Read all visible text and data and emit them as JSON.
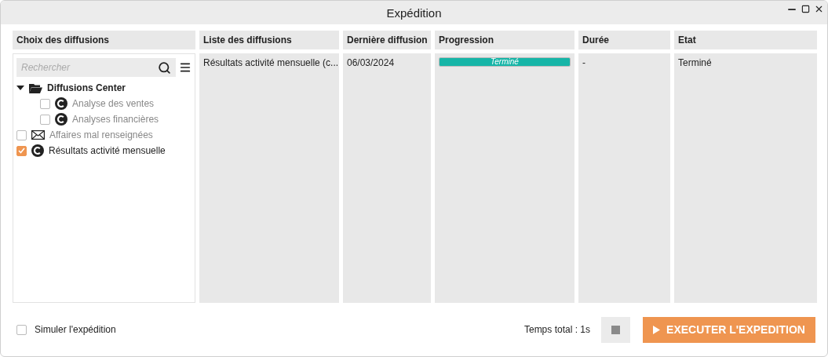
{
  "window": {
    "title": "Expédition"
  },
  "sidebar": {
    "header": "Choix des diffusions",
    "search": {
      "placeholder": "Rechercher"
    },
    "tree": [
      {
        "label": "Diffusions Center",
        "kind": "folder",
        "expanded": true,
        "children": [
          {
            "label": "Analyse des ventes",
            "kind": "report",
            "checked": false
          },
          {
            "label": "Analyses financières",
            "kind": "report",
            "checked": false
          }
        ]
      },
      {
        "label": "Affaires mal renseignées",
        "kind": "mail",
        "checked": false
      },
      {
        "label": "Résultats activité mensuelle",
        "kind": "report",
        "checked": true
      }
    ]
  },
  "table": {
    "columns": [
      "Liste des diffusions",
      "Dernière diffusion",
      "Progression",
      "Durée",
      "Etat"
    ],
    "rows": [
      {
        "name": "Résultats activité mensuelle (c...",
        "last": "06/03/2024",
        "progress": {
          "label": "Terminé",
          "level": 1
        },
        "duration": "-",
        "state": "Terminé"
      }
    ]
  },
  "footer": {
    "simulate": {
      "label": "Simuler l'expédition",
      "checked": false
    },
    "total": "Temps total : 1s",
    "run_button": "EXECUTER L'EXPEDITION"
  }
}
